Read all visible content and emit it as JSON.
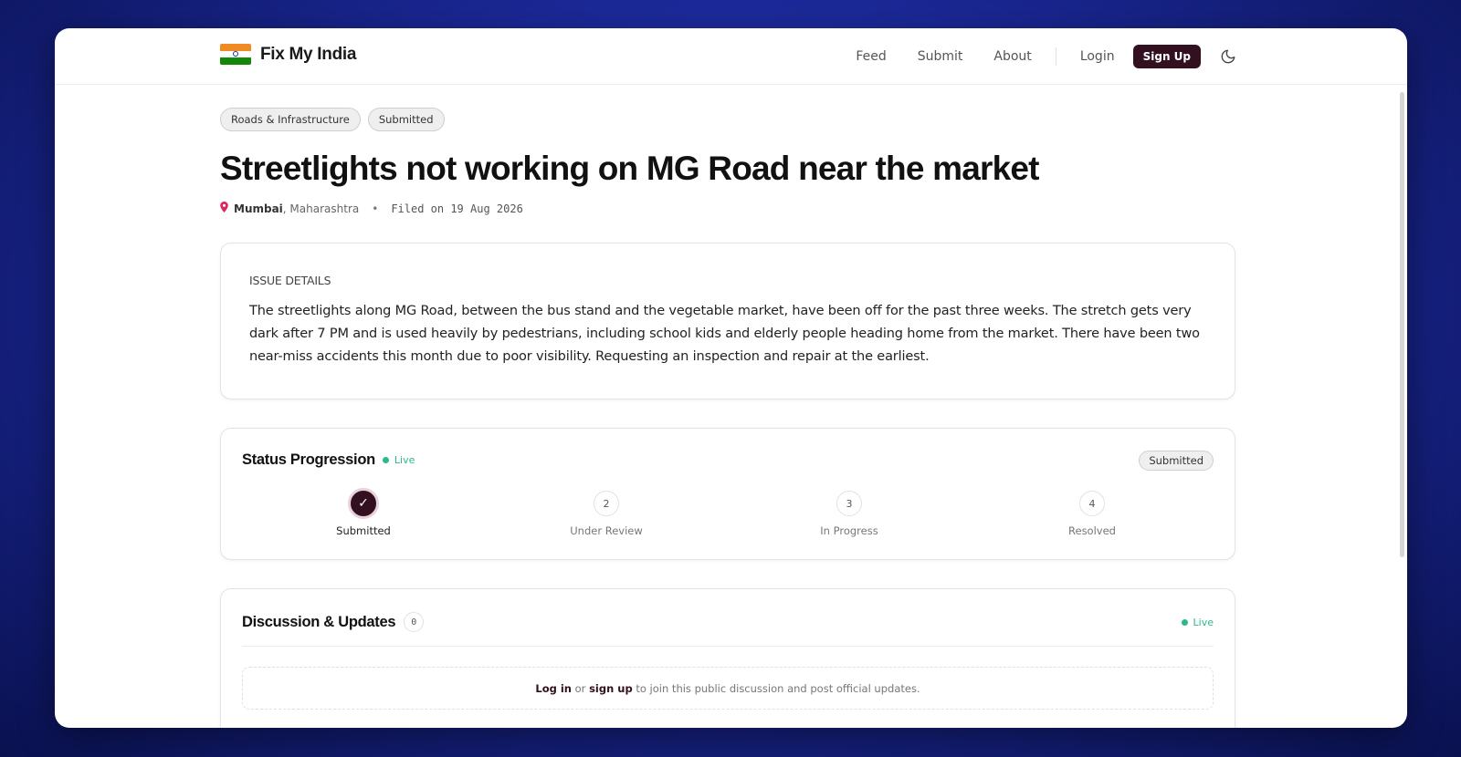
{
  "brand": {
    "name": "Fix My India",
    "logo_icon": "india-flag-icon"
  },
  "nav": {
    "links": [
      "Feed",
      "Submit",
      "About",
      "Login"
    ],
    "signup_label": "Sign Up",
    "theme_icon": "moon-icon"
  },
  "issue": {
    "tags": [
      "Roads & Infrastructure",
      "Submitted"
    ],
    "title": "Streetlights not working on MG Road near the market",
    "city": "Mumbai",
    "state": ", Maharashtra",
    "separator": "•",
    "filed": "Filed on 19 Aug 2026",
    "details_label": "ISSUE DETAILS",
    "details_text": "The streetlights along MG Road, between the bus stand and the vegetable market, have been off for the past three weeks. The stretch gets very dark after 7 PM and is used heavily by pedestrians, including school kids and elderly people heading home from the market. There have been two near-miss accidents this month due to poor visibility. Requesting an inspection and repair at the earliest."
  },
  "status": {
    "title": "Status Progression",
    "live_label": "Live",
    "current_badge": "Submitted",
    "steps": [
      {
        "marker": "✓",
        "label": "Submitted",
        "active": true
      },
      {
        "marker": "2",
        "label": "Under Review",
        "active": false
      },
      {
        "marker": "3",
        "label": "In Progress",
        "active": false
      },
      {
        "marker": "4",
        "label": "Resolved",
        "active": false
      }
    ]
  },
  "discussion": {
    "title": "Discussion & Updates",
    "count": "0",
    "live_label": "Live",
    "login_link": "Log in",
    "or_text": " or ",
    "signup_link": "sign up",
    "suffix": " to join this public discussion and post official updates."
  },
  "colors": {
    "accent": "#33101f",
    "live_green": "#2cb98a",
    "pin_red": "#e0245e"
  }
}
